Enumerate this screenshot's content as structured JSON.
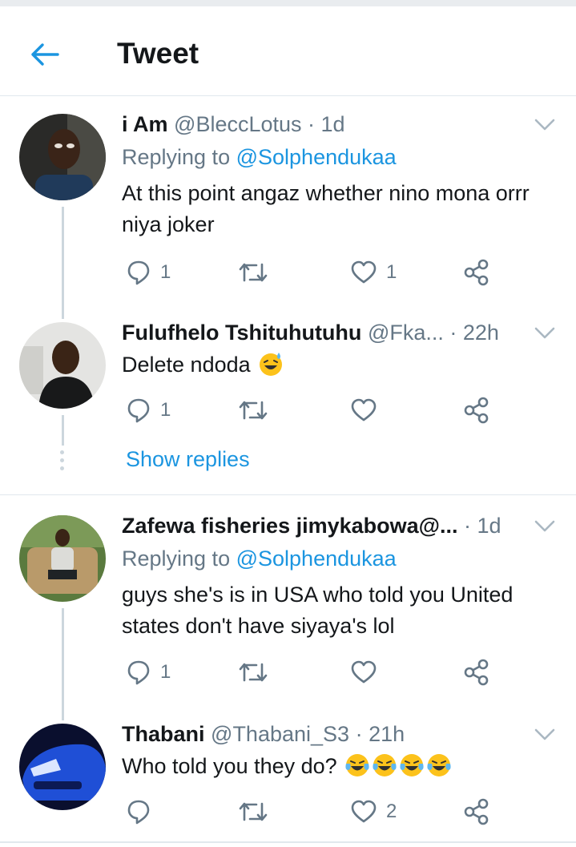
{
  "header": {
    "title": "Tweet"
  },
  "tweets": [
    {
      "name": "i Am",
      "handle": "@BleccLotus",
      "time": "· 1d",
      "replying_prefix": "Replying to",
      "replying_to": "@Solphendukaa",
      "text": "At this point angaz whether nino mona orrr niya joker",
      "replies": "1",
      "retweets": "",
      "likes": "1"
    },
    {
      "name": "Fulufhelo Tshituhutuhu",
      "handle": "@Fka...",
      "time": "· 22h",
      "text": "Delete ndoda",
      "emoji": [
        "sweat-smile-emoji"
      ],
      "replies": "1",
      "retweets": "",
      "likes": ""
    },
    {
      "name": "Zafewa fisheries jimykabowa@...",
      "handle": "",
      "time": "· 1d",
      "replying_prefix": "Replying to",
      "replying_to": "@Solphendukaa",
      "text": "guys she's is in USA who told you United states don't have siyaya's lol",
      "replies": "1",
      "retweets": "",
      "likes": ""
    },
    {
      "name": "Thabani",
      "handle": "@Thabani_S3",
      "time": "· 21h",
      "text": "Who told you they do?",
      "emoji": [
        "joy-emoji",
        "joy-emoji",
        "joy-emoji",
        "joy-emoji"
      ],
      "replies": "",
      "retweets": "",
      "likes": "2"
    }
  ],
  "show_replies": "Show replies",
  "colors": {
    "accent": "#1b95e0",
    "muted": "#657786",
    "text": "#14171a",
    "line": "#ccd6dd"
  }
}
